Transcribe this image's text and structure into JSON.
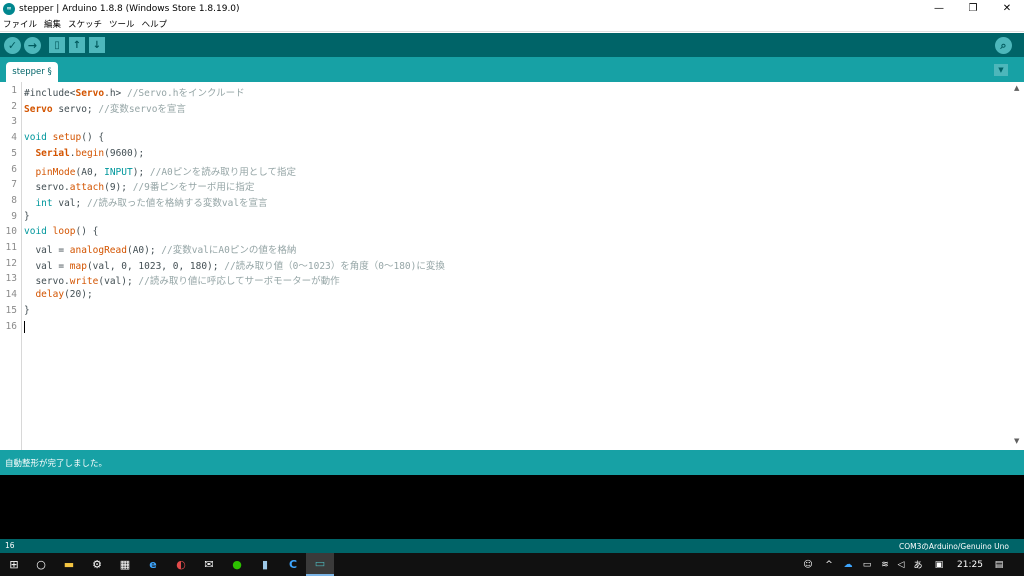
{
  "window": {
    "title": "stepper | Arduino 1.8.8 (Windows Store 1.8.19.0)",
    "app_icon_text": "∞",
    "minimize": "—",
    "restore": "❐",
    "close": "✕"
  },
  "menu": [
    "ファイル",
    "編集",
    "スケッチ",
    "ツール",
    "ヘルプ"
  ],
  "toolbar": {
    "verify_glyph": "✓",
    "upload_glyph": "→",
    "new_glyph": "▯",
    "open_glyph": "↑",
    "save_glyph": "↓",
    "serial_monitor_glyph": "⌕"
  },
  "tabs": {
    "active": "stepper §",
    "menu_glyph": "▼"
  },
  "editor": {
    "line_numbers": [
      "1",
      "2",
      "3",
      "4",
      "5",
      "6",
      "7",
      "8",
      "9",
      "10",
      "11",
      "12",
      "13",
      "14",
      "15",
      "16"
    ],
    "lines": [
      [
        {
          "t": "#include<",
          "c": "plain"
        },
        {
          "t": "Servo",
          "c": "class"
        },
        {
          "t": ".h> ",
          "c": "plain"
        },
        {
          "t": "//Servo.hをインクルード",
          "c": "comment"
        }
      ],
      [
        {
          "t": "Servo",
          "c": "class"
        },
        {
          "t": " servo; ",
          "c": "plain"
        },
        {
          "t": "//変数servoを宣言",
          "c": "comment"
        }
      ],
      [],
      [
        {
          "t": "void",
          "c": "type"
        },
        {
          "t": " ",
          "c": "plain"
        },
        {
          "t": "setup",
          "c": "fn"
        },
        {
          "t": "() {",
          "c": "plain"
        }
      ],
      [
        {
          "t": "  ",
          "c": "plain"
        },
        {
          "t": "Serial",
          "c": "class"
        },
        {
          "t": ".",
          "c": "plain"
        },
        {
          "t": "begin",
          "c": "fn"
        },
        {
          "t": "(9600);",
          "c": "plain"
        }
      ],
      [
        {
          "t": "  ",
          "c": "plain"
        },
        {
          "t": "pinMode",
          "c": "fn"
        },
        {
          "t": "(A0, ",
          "c": "plain"
        },
        {
          "t": "INPUT",
          "c": "const"
        },
        {
          "t": "); ",
          "c": "plain"
        },
        {
          "t": "//A0ピンを読み取り用として指定",
          "c": "comment"
        }
      ],
      [
        {
          "t": "  servo.",
          "c": "plain"
        },
        {
          "t": "attach",
          "c": "fn"
        },
        {
          "t": "(9); ",
          "c": "plain"
        },
        {
          "t": "//9番ピンをサーボ用に指定",
          "c": "comment"
        }
      ],
      [
        {
          "t": "  ",
          "c": "plain"
        },
        {
          "t": "int",
          "c": "type"
        },
        {
          "t": " val; ",
          "c": "plain"
        },
        {
          "t": "//読み取った値を格納する変数valを宣言",
          "c": "comment"
        }
      ],
      [
        {
          "t": "}",
          "c": "plain"
        }
      ],
      [
        {
          "t": "void",
          "c": "type"
        },
        {
          "t": " ",
          "c": "plain"
        },
        {
          "t": "loop",
          "c": "fn"
        },
        {
          "t": "() {",
          "c": "plain"
        }
      ],
      [
        {
          "t": "  val = ",
          "c": "plain"
        },
        {
          "t": "analogRead",
          "c": "fn"
        },
        {
          "t": "(A0); ",
          "c": "plain"
        },
        {
          "t": "//変数valにA0ピンの値を格納",
          "c": "comment"
        }
      ],
      [
        {
          "t": "  val = ",
          "c": "plain"
        },
        {
          "t": "map",
          "c": "fn"
        },
        {
          "t": "(val, 0, 1023, 0, 180); ",
          "c": "plain"
        },
        {
          "t": "//読み取り値（0〜1023）を角度（0〜180)に変換",
          "c": "comment"
        }
      ],
      [
        {
          "t": "  servo.",
          "c": "plain"
        },
        {
          "t": "write",
          "c": "fn"
        },
        {
          "t": "(val); ",
          "c": "plain"
        },
        {
          "t": "//読み取り値に呼応してサーボモーターが動作",
          "c": "comment"
        }
      ],
      [
        {
          "t": "  ",
          "c": "plain"
        },
        {
          "t": "delay",
          "c": "fn"
        },
        {
          "t": "(20);",
          "c": "plain"
        }
      ],
      [
        {
          "t": "}",
          "c": "plain"
        }
      ],
      []
    ],
    "scroll_up": "▲",
    "scroll_down": "▼"
  },
  "status": {
    "message": "自動整形が完了しました。"
  },
  "footer": {
    "line": "16",
    "board": "COM3のArduino/Genuino Uno"
  },
  "taskbar": {
    "clock": "21:25",
    "ime": "あ",
    "icons": [
      "⊞",
      "○",
      "▬",
      "⚙",
      "▦",
      "e",
      "◐",
      "✉",
      "●",
      "▮",
      "C",
      "▭"
    ]
  },
  "colors": {
    "toolbar_bg": "#006468",
    "tab_bar_bg": "#17a1a5",
    "keyword": "#00979c",
    "function": "#d35400",
    "comment": "#95a5a6"
  }
}
